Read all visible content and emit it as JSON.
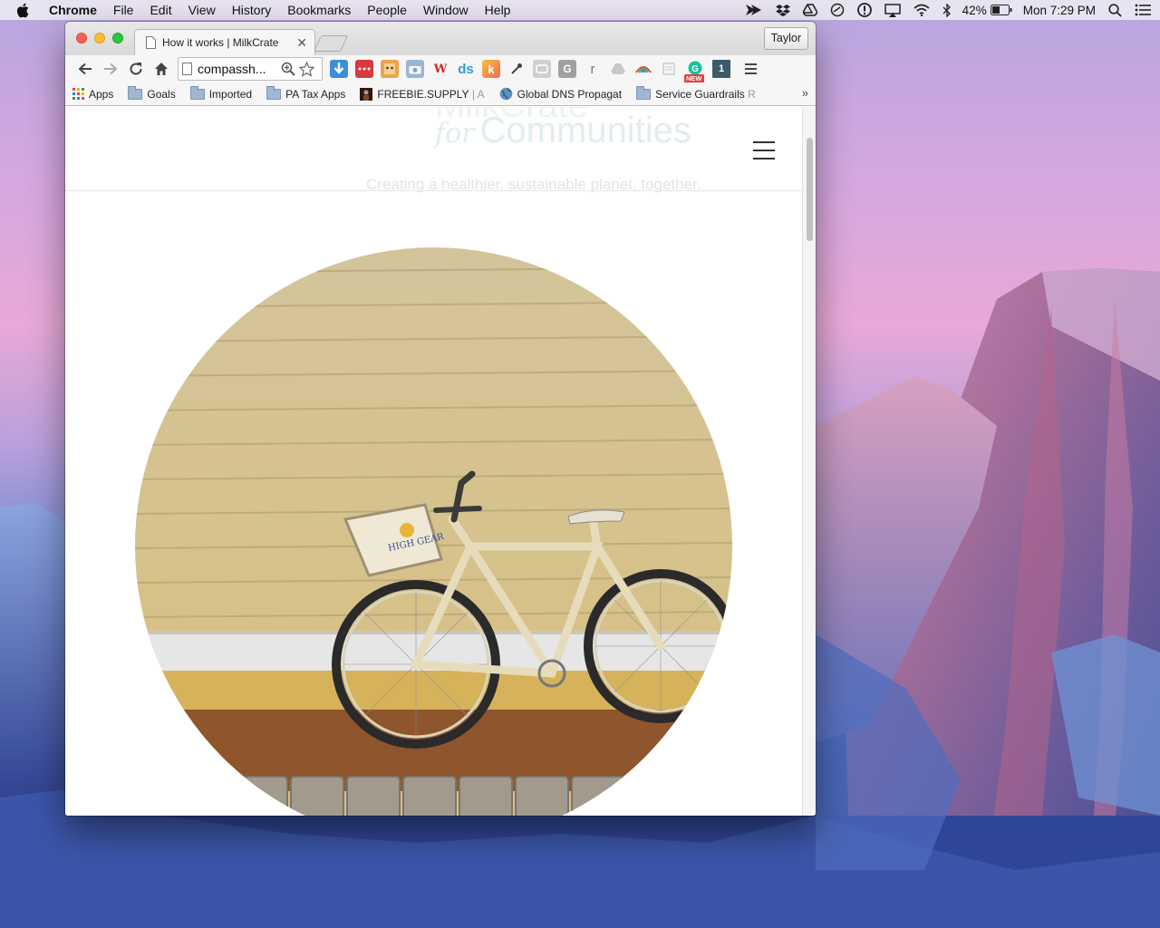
{
  "menubar": {
    "app_name": "Chrome",
    "items": [
      "File",
      "Edit",
      "View",
      "History",
      "Bookmarks",
      "People",
      "Window",
      "Help"
    ],
    "battery": "42%",
    "clock": "Mon 7:29 PM"
  },
  "browser": {
    "tab_title": "How it works | MilkCrate",
    "profile_name": "Taylor",
    "url": "compassh...",
    "extensions": {
      "ext_new_badge": "NEW",
      "ext_count": "1",
      "ext_w": "W",
      "ext_ds": "ds",
      "ext_k": "k",
      "ext_g": "G",
      "ext_r": "r"
    },
    "bookmarks": {
      "apps": "Apps",
      "goals": "Goals",
      "imported": "Imported",
      "pa_tax": "PA Tax Apps",
      "freebie": "FREEBIE.SUPPLY",
      "freebie_fade": "| A",
      "dns": "Global DNS Propagat",
      "guardrails": "Service Guardrails",
      "guardrails_fade": "R"
    }
  },
  "page": {
    "logo_word_top": "MilkCrate",
    "logo_for": "for",
    "logo_word": "Communities",
    "tagline": "Creating a healthier, sustainable planet, together."
  },
  "colors": {
    "accent_red": "#fc5f57",
    "accent_yellow": "#fdbc2e",
    "accent_green": "#28c840"
  }
}
